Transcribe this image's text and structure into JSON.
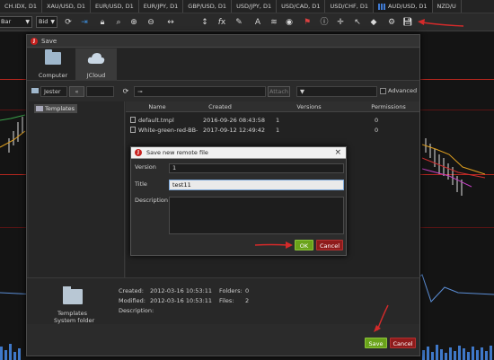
{
  "tabs": [
    {
      "label": "CH.IDX, D1"
    },
    {
      "label": "XAU/USD, D1"
    },
    {
      "label": "EUR/USD, D1"
    },
    {
      "label": "EUR/JPY, D1"
    },
    {
      "label": "GBP/USD, D1"
    },
    {
      "label": "USD/JPY, D1"
    },
    {
      "label": "USD/CAD, D1"
    },
    {
      "label": "USD/CHF, D1"
    },
    {
      "label": "AUD/USD, D1"
    },
    {
      "label": "NZD/U"
    }
  ],
  "tab_close": "×",
  "toolbar": {
    "chart_type": "Bar",
    "price_type": "Bid",
    "icons": [
      "refresh-icon",
      "arrow-right-icon",
      "lock-icon",
      "zoom-icon",
      "zoom-in-icon",
      "zoom-out-icon",
      "fit-horizontal-icon",
      "fit-vertical-icon",
      "fx-icon",
      "pencil-icon",
      "text-icon",
      "layers-icon",
      "eye-icon",
      "alert-icon",
      "info-icon",
      "crosshair-icon",
      "cursor-icon",
      "paint-icon",
      "settings-icon",
      "save-icon"
    ]
  },
  "save_dialog": {
    "title": "Save",
    "locations": [
      {
        "label": "Computer"
      },
      {
        "label": "JCloud"
      }
    ],
    "path_user": "Jester",
    "back_symbol": "«",
    "key_symbol": "⊸",
    "attach_label": "Attach",
    "filter_symbol": "▼",
    "advanced_label": "Advanced",
    "tree": [
      "Templates"
    ],
    "file_columns": [
      "Name",
      "Created",
      "Versions",
      "Permissions"
    ],
    "files": [
      {
        "name": "default.tmpl",
        "created": "2016-09-26 08:43:58",
        "versions": "1",
        "permissions": "0"
      },
      {
        "name": "White-green-red-BB-",
        "created": "2017-09-12 12:49:42",
        "versions": "1",
        "permissions": "0"
      }
    ],
    "info": {
      "folder_label": "Templates",
      "folder_type": "System folder",
      "created_label": "Created:",
      "created_value": "2012-03-16 10:53:11",
      "modified_label": "Modified:",
      "modified_value": "2012-03-16 10:53:11",
      "description_label": "Description:",
      "folders_label": "Folders:",
      "folders_value": "0",
      "files_label": "Files:",
      "files_value": "2"
    },
    "save_button": "Save",
    "cancel_button": "Cancel"
  },
  "remote_dialog": {
    "title": "Save new remote file",
    "close": "×",
    "version_label": "Version",
    "version_value": "1",
    "title_label": "Title",
    "title_value": "test11",
    "description_label": "Description",
    "description_value": "",
    "ok_button": "OK",
    "cancel_button": "Cancel"
  },
  "colors": {
    "ok_green": "#6aa31a",
    "cancel_red": "#8f1b1b",
    "annotation_red": "#d42a2a",
    "level_line": "#b3261e"
  }
}
